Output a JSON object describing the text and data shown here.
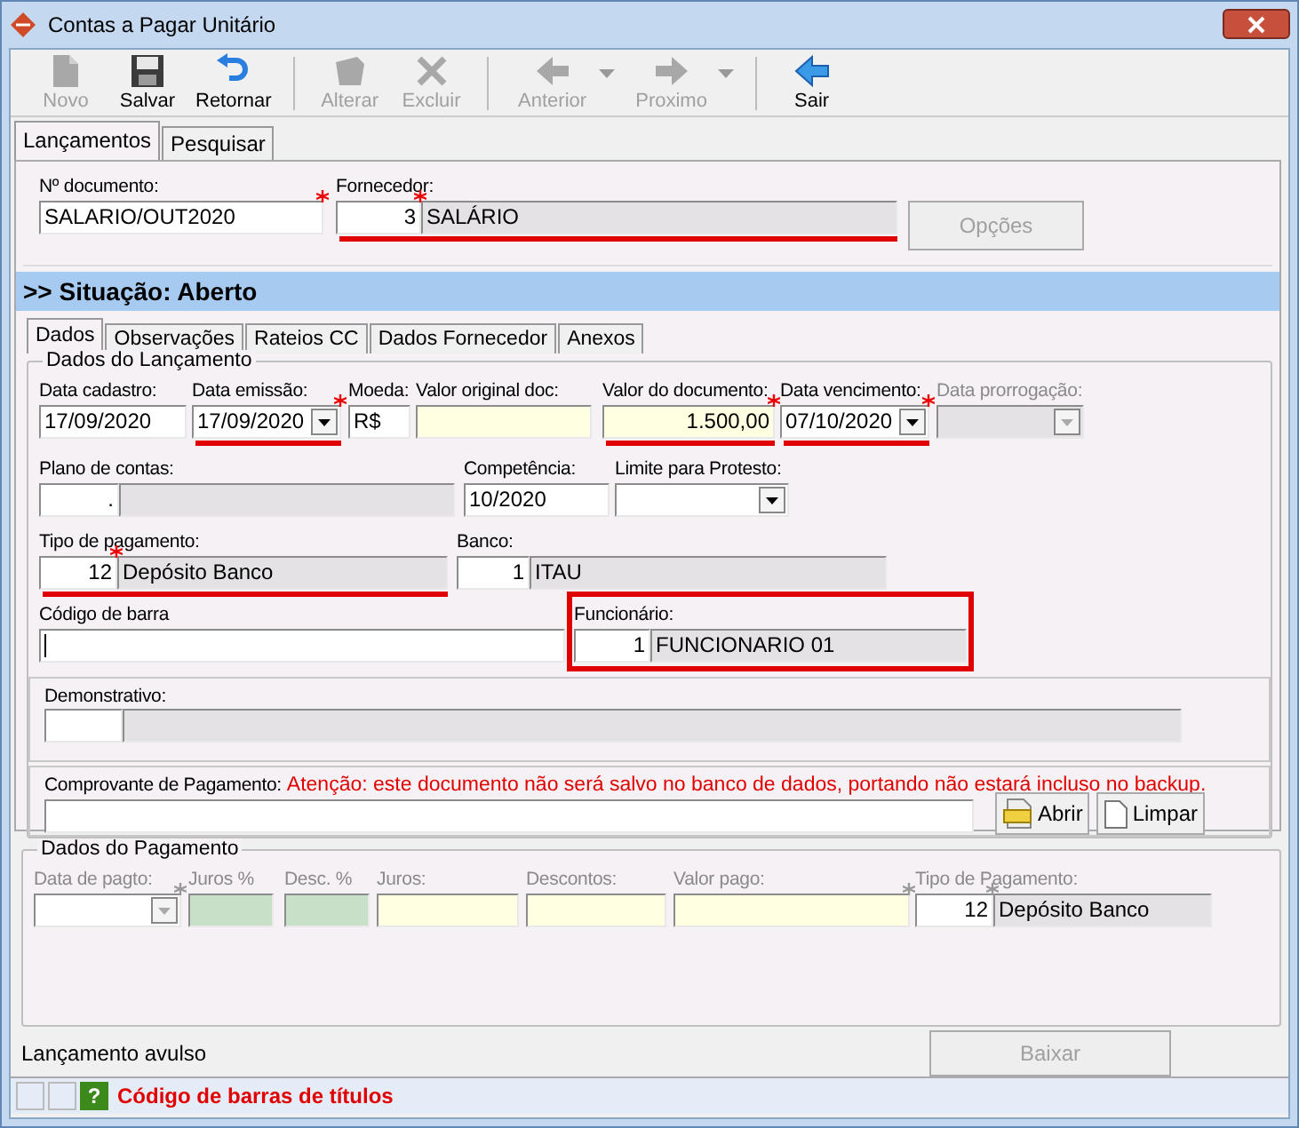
{
  "window": {
    "title": "Contas a Pagar Unitário"
  },
  "toolbar": [
    [
      {
        "label": "Novo",
        "kind": "new",
        "disabled": true,
        "menu": false
      },
      {
        "label": "Salvar",
        "kind": "save",
        "disabled": false,
        "menu": false
      },
      {
        "label": "Retornar",
        "kind": "undo",
        "disabled": false,
        "menu": false
      }
    ],
    [
      {
        "label": "Alterar",
        "kind": "edit",
        "disabled": true,
        "menu": false
      },
      {
        "label": "Excluir",
        "kind": "delete",
        "disabled": true,
        "menu": false
      }
    ],
    [
      {
        "label": "Anterior",
        "kind": "left",
        "disabled": true,
        "menu": true
      },
      {
        "label": "Proximo",
        "kind": "right",
        "disabled": true,
        "menu": true
      }
    ],
    [
      {
        "label": "Sair",
        "kind": "exit",
        "disabled": false,
        "menu": false
      }
    ]
  ],
  "tabs": [
    {
      "label": "Lançamentos",
      "selected": true
    },
    {
      "label": "Pesquisar",
      "selected": false
    }
  ],
  "header": {
    "fields": [
      {
        "label": "Nº documento:",
        "kind": "text",
        "value": "SALARIO/OUT2020",
        "required": true,
        "disabled": false
      },
      {
        "label": "Fornecedor:",
        "kind": "lookup",
        "code": "3",
        "name": "SALÁRIO",
        "required": true,
        "disabled": false,
        "underlined": true
      }
    ],
    "button": {
      "label": "Opções",
      "disabled": true
    }
  },
  "status_band": ">> Situação: Aberto",
  "subtabs": [
    {
      "label": "Dados",
      "selected": true
    },
    {
      "label": "Observações",
      "selected": false
    },
    {
      "label": "Rateios CC",
      "selected": false
    },
    {
      "label": "Dados Fornecedor",
      "selected": false
    },
    {
      "label": "Anexos",
      "selected": false
    }
  ],
  "launch_group": {
    "title": "Dados do Lançamento",
    "fields": [
      {
        "label": "Data cadastro:",
        "kind": "text",
        "value": "17/09/2020",
        "disabled": false
      },
      {
        "label": "Data emissão:",
        "kind": "dropdown",
        "value": "17/09/2020",
        "required": true,
        "disabled": false,
        "underlined": true
      },
      {
        "label": "Moeda:",
        "kind": "text",
        "value": "R$",
        "disabled": false
      },
      {
        "label": "Valor original doc:",
        "kind": "text",
        "color": "#ffffe1",
        "disabled": false
      },
      {
        "label": "Valor do documento:",
        "kind": "number",
        "value": "1.500,00",
        "color": "#ffffe1",
        "required": true,
        "disabled": false,
        "underlined": true
      },
      {
        "label": "Data vencimento:",
        "kind": "dropdown",
        "value": "07/10/2020",
        "required": true,
        "disabled": false,
        "underlined": true
      },
      {
        "label": "Data prorrogação:",
        "kind": "dropdown",
        "disabled": true
      },
      {
        "label": "Plano de contas:",
        "kind": "lookup",
        "code": ".",
        "disabled": false
      },
      {
        "label": "Competência:",
        "kind": "text",
        "value": "10/2020",
        "disabled": false
      },
      {
        "label": "Limite para Protesto:",
        "kind": "dropdown",
        "disabled": false
      },
      {
        "label": "Tipo de pagamento:",
        "kind": "lookup",
        "code": "12",
        "name": "Depósito Banco",
        "required": true,
        "disabled": false,
        "underlined": true
      },
      {
        "label": "Banco:",
        "kind": "lookup",
        "code": "1",
        "name": "ITAU",
        "disabled": false
      },
      {
        "label": "Código de barra",
        "kind": "text",
        "disabled": false,
        "focused": true
      },
      {
        "label": "Funcionário:",
        "kind": "lookup",
        "code": "1",
        "name": "FUNCIONARIO 01",
        "disabled": false,
        "boxed": true
      }
    ],
    "statement": {
      "label": "Demonstrativo:"
    },
    "receipt": {
      "label": "Comprovante de Pagamento:",
      "warning": "Atenção: este documento não será salvo no banco de dados, portando não estará incluso no backup.",
      "buttons": [
        {
          "label": "Abrir",
          "kind": "doc"
        },
        {
          "label": "Limpar",
          "kind": "page"
        }
      ]
    }
  },
  "payment_group": {
    "title": "Dados do Pagamento",
    "fields": [
      {
        "label": "Data de pagto:",
        "kind": "dropdown",
        "required": true,
        "disabled": true
      },
      {
        "label": "Juros %",
        "kind": "text",
        "color": "#c8dfc8",
        "disabled": true
      },
      {
        "label": "Desc. %",
        "kind": "text",
        "color": "#c8dfc8",
        "disabled": true
      },
      {
        "label": "Juros:",
        "kind": "text",
        "color": "#ffffe1",
        "disabled": true
      },
      {
        "label": "Descontos:",
        "kind": "text",
        "color": "#ffffe1",
        "disabled": true
      },
      {
        "label": "Valor pago:",
        "kind": "text",
        "color": "#ffffe1",
        "required": true,
        "disabled": true
      },
      {
        "label": "Tipo de Pagamento:",
        "kind": "lookup",
        "code": "12",
        "name": "Depósito Banco",
        "required": true,
        "disabled": true
      }
    ]
  },
  "footer": {
    "text": "Lançamento avulso",
    "button": {
      "label": "Baixar",
      "disabled": true
    }
  },
  "status_bar": {
    "help_glyph": "?",
    "message": "Código de barras de títulos"
  }
}
